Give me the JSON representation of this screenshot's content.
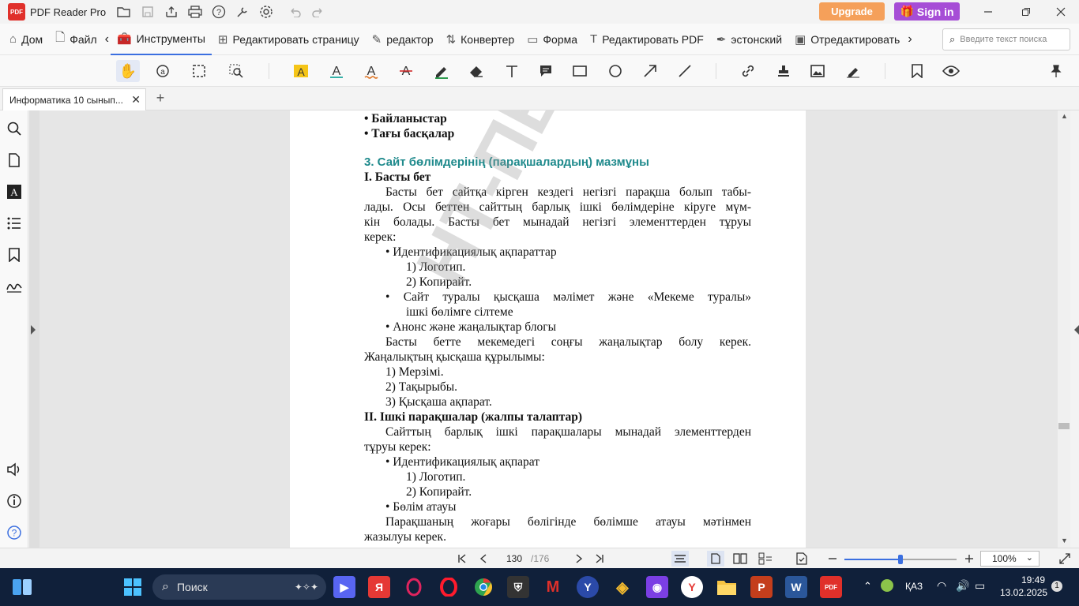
{
  "titlebar": {
    "logo_text": "PDF",
    "app_name": "PDF Reader Pro",
    "upgrade_label": "Upgrade",
    "signin_label": "Sign in"
  },
  "menu": {
    "items": [
      "Дом",
      "Файл",
      "Инструменты",
      "Редактировать страницу",
      "редактор",
      "Конвертер",
      "Форма",
      "Редактировать PDF",
      "эстонский",
      "Отредактировать"
    ],
    "active": "Инструменты",
    "search_placeholder": "Введите текст поиска"
  },
  "tab": {
    "title": "Информатика 10  сынып..."
  },
  "document": {
    "watermark": "НТ-ПВ баспасы",
    "lines": [
      {
        "text": "•    Байланыстар",
        "style": "bold"
      },
      {
        "text": "•    Тағы басқалар",
        "style": "bold"
      },
      {
        "text": "3. Сайт бөлімдерінің (парақшалардың) мазмұны",
        "style": "heading"
      },
      {
        "text": "I.    Басты бет",
        "style": "bold"
      },
      {
        "text": "Басты бет сайтқа кірген кездегі негізгі парақша болып табы-",
        "style": "justify-indent"
      },
      {
        "text": "лады. Осы беттен сайттың барлық ішкі бөлімдеріне кіруге мүм-",
        "style": "justify"
      },
      {
        "text": "кін болады. Басты бет мынадай негізгі элементтерден тұруы",
        "style": "justify"
      },
      {
        "text": "керек:",
        "style": "plain"
      },
      {
        "text": "•    Идентификациялық ақпараттар",
        "style": "bullet"
      },
      {
        "text": "1)  Логотип.",
        "style": "sub"
      },
      {
        "text": "2)  Копирайт.",
        "style": "sub"
      },
      {
        "text": "•    Сайт туралы қысқаша мәлімет және «Мекеме туралы»",
        "style": "bullet-justify"
      },
      {
        "text": "ішкі бөлімге сілтеме",
        "style": "sub"
      },
      {
        "text": "•    Анонс және жаңалықтар блогы",
        "style": "bullet"
      },
      {
        "text": "Басты бетте мекемедегі соңғы жаңалықтар болу керек.",
        "style": "justify-indent"
      },
      {
        "text": "Жаңалықтың қысқаша құрылымы:",
        "style": "plain"
      },
      {
        "text": "1)   Мерзімі.",
        "style": "num"
      },
      {
        "text": "2)   Тақырыбы.",
        "style": "num"
      },
      {
        "text": "3)   Қысқаша ақпарат.",
        "style": "num"
      },
      {
        "text": "II.   Ішкі парақшалар (жалпы талаптар)",
        "style": "bold"
      },
      {
        "text": "Сайттың барлық ішкі парақшалары мынадай элементтерден",
        "style": "justify-indent"
      },
      {
        "text": "тұруы керек:",
        "style": "plain"
      },
      {
        "text": "•    Идентификациялық ақпарат",
        "style": "bullet"
      },
      {
        "text": "1)  Логотип.",
        "style": "sub"
      },
      {
        "text": "2)  Копирайт.",
        "style": "sub"
      },
      {
        "text": "•    Бөлім атауы",
        "style": "bullet"
      },
      {
        "text": "Парақшаның жоғары бөлігінде бөлімше атауы мәтінмен",
        "style": "justify-indent"
      },
      {
        "text": "жазылуы керек.",
        "style": "plain"
      }
    ]
  },
  "statusbar": {
    "current_page": "130",
    "total_pages": "/176",
    "zoom": "100%",
    "zoom_level": 0.5
  },
  "taskbar": {
    "search_label": "Поиск",
    "language": "ҚАЗ",
    "time": "19:49",
    "date": "13.02.2025",
    "notification_count": "1"
  },
  "colors": {
    "accent": "#3b6fe0",
    "heading": "#1f8a8c",
    "upgrade": "#f5a05a",
    "signin": "#a64dd6",
    "taskbar": "#10203a"
  }
}
